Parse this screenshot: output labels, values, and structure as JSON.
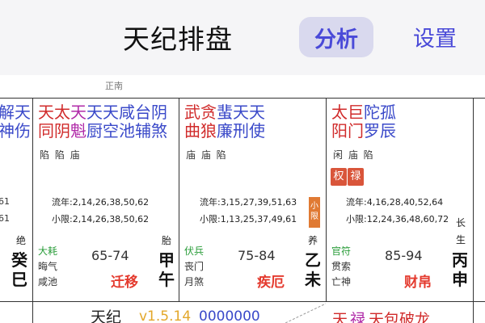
{
  "header": {
    "title": "天纪排盘",
    "analyze_label": "分析",
    "settings_label": "设置"
  },
  "direction_label": "正南",
  "left_edge": {
    "star_row1": "解天",
    "star_row2": "神伤",
    "n1": "61",
    "n2": "61",
    "stage": "绝",
    "gz1": "癸",
    "gz2": "巳"
  },
  "palaces": [
    {
      "stars_row1": [
        {
          "t": "天",
          "c": "r"
        },
        {
          "t": "太",
          "c": "r"
        },
        {
          "t": "天",
          "c": "p"
        },
        {
          "t": "天",
          "c": "b"
        },
        {
          "t": "天",
          "c": "b"
        },
        {
          "t": "咸",
          "c": "b"
        },
        {
          "t": "台",
          "c": "b"
        },
        {
          "t": "阴",
          "c": "b"
        }
      ],
      "stars_row2": [
        {
          "t": "同",
          "c": "r"
        },
        {
          "t": "阴",
          "c": "r"
        },
        {
          "t": "魁",
          "c": "p"
        },
        {
          "t": "厨",
          "c": "b"
        },
        {
          "t": "空",
          "c": "b"
        },
        {
          "t": "池",
          "c": "b"
        },
        {
          "t": "辅",
          "c": "b"
        },
        {
          "t": "煞",
          "c": "b"
        }
      ],
      "brightness": "陷 陷 庙",
      "liunian": "流年:2,14,26,38,50,62",
      "xiaoxian": "小限:2,14,26,38,50,62",
      "god1": "大耗",
      "god2": "晦气",
      "god3": "咸池",
      "age": "65-74",
      "name": "迁移",
      "stage": "胎",
      "gz1": "甲",
      "gz2": "午"
    },
    {
      "stars_row1": [
        {
          "t": "武",
          "c": "r"
        },
        {
          "t": "贪",
          "c": "r"
        },
        {
          "t": "蜚",
          "c": "b"
        },
        {
          "t": "天",
          "c": "b"
        },
        {
          "t": "天",
          "c": "b"
        }
      ],
      "stars_row2": [
        {
          "t": "曲",
          "c": "r"
        },
        {
          "t": "狼",
          "c": "r"
        },
        {
          "t": "廉",
          "c": "b"
        },
        {
          "t": "刑",
          "c": "b"
        },
        {
          "t": "使",
          "c": "b"
        }
      ],
      "brightness": "庙 庙    陷",
      "liunian": "流年:3,15,27,39,51,63",
      "xiaoxian": "小限:1,13,25,37,49,61",
      "xiaoxian_badge": "小限",
      "god1": "伏兵",
      "god2": "丧门",
      "god3": "月煞",
      "age": "75-84",
      "name": "疾厄",
      "stage": "养",
      "gz1": "乙",
      "gz2": "未"
    },
    {
      "stars_row1": [
        {
          "t": "太",
          "c": "r"
        },
        {
          "t": "巨",
          "c": "r"
        },
        {
          "t": "陀",
          "c": "b"
        },
        {
          "t": "孤",
          "c": "b"
        }
      ],
      "stars_row2": [
        {
          "t": "阳",
          "c": "r"
        },
        {
          "t": "门",
          "c": "r"
        },
        {
          "t": "罗",
          "c": "b"
        },
        {
          "t": "辰",
          "c": "b"
        }
      ],
      "brightness": "闲 庙 陷",
      "tags": [
        {
          "t": "权",
          "color": "#d9553a"
        },
        {
          "t": "禄",
          "color": "#d9553a"
        }
      ],
      "liunian": "流年:4,16,28,40,52,64",
      "xiaoxian": "小限:12,24,36,48,60,72",
      "god1": "官符",
      "god2": "贯索",
      "god3": "亡神",
      "age": "85-94",
      "name": "财帛",
      "stage": "长生",
      "gz1": "丙",
      "gz2": "申"
    }
  ],
  "bottom": {
    "center_a": "天纪",
    "center_b": "v1.5.14",
    "center_c": "0000000",
    "right_a": "天",
    "right_b": "禄",
    "right_c": "天包破龙"
  }
}
